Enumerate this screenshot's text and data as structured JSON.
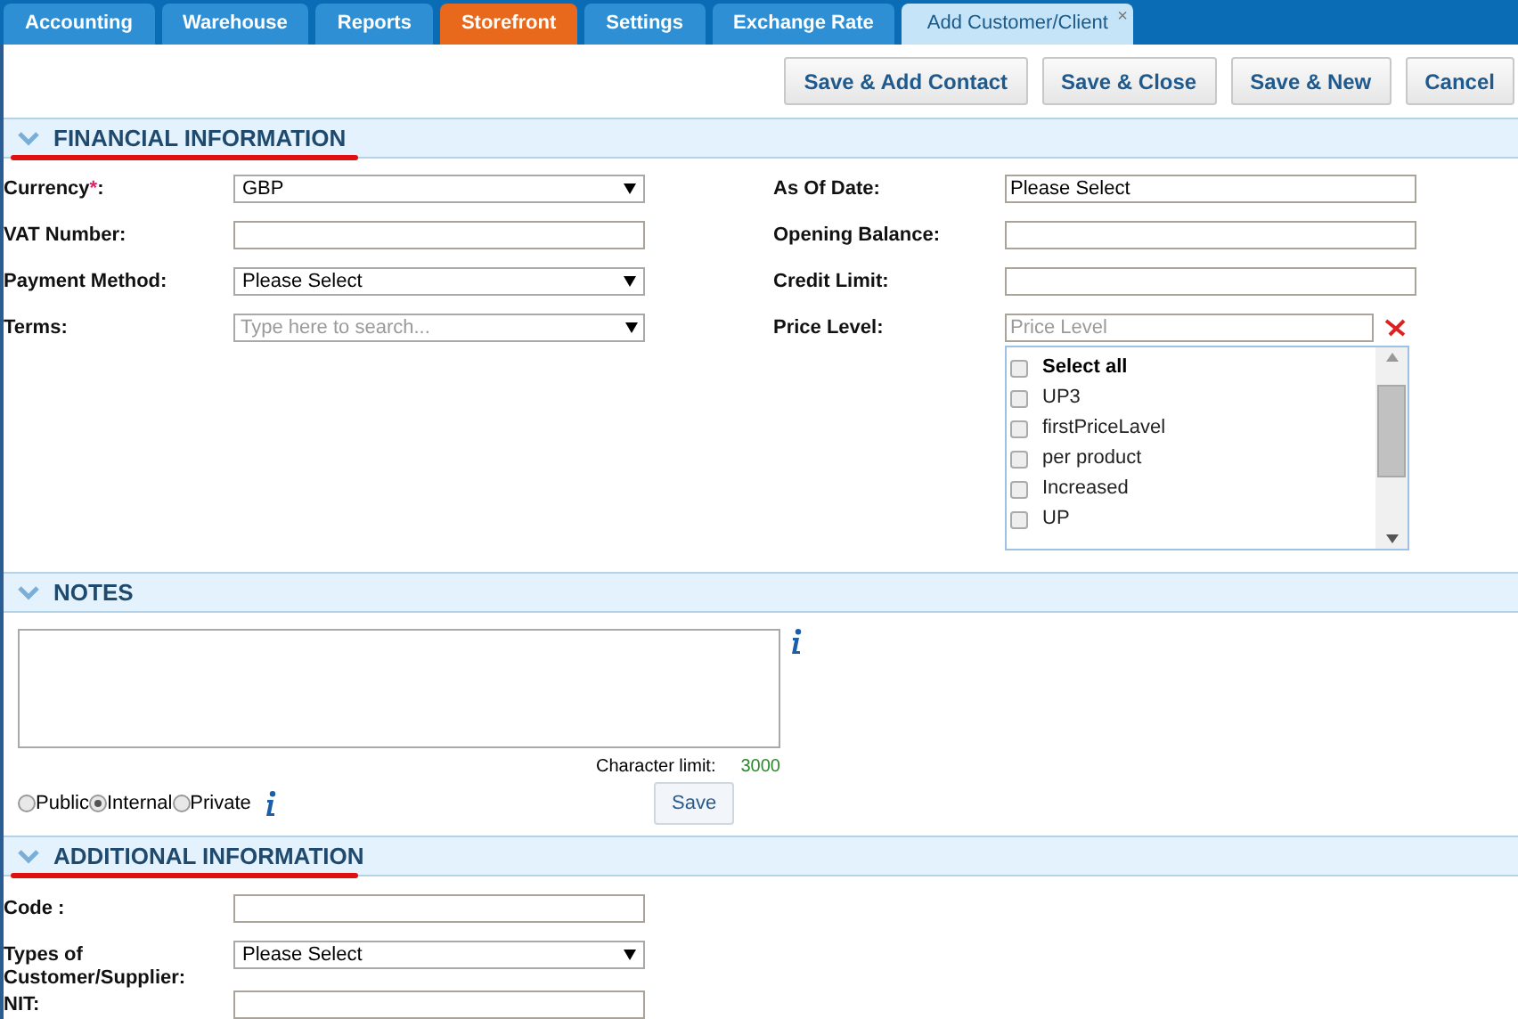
{
  "tabs": [
    {
      "label": "Accounting",
      "selected": false,
      "accent": false
    },
    {
      "label": "Warehouse",
      "selected": false,
      "accent": false
    },
    {
      "label": "Reports",
      "selected": false,
      "accent": false
    },
    {
      "label": "Storefront",
      "selected": false,
      "accent": true
    },
    {
      "label": "Settings",
      "selected": false,
      "accent": false
    },
    {
      "label": "Exchange Rate",
      "selected": false,
      "accent": false
    },
    {
      "label": "Add Customer/Client",
      "selected": true,
      "accent": false,
      "close": "×"
    }
  ],
  "toolbar": {
    "buttons": [
      "Save & Add Contact",
      "Save & Close",
      "Save & New",
      "Cancel"
    ]
  },
  "financial": {
    "title": "FINANCIAL INFORMATION",
    "marked": true,
    "left_fields": [
      {
        "kind": "select",
        "label": "Currency",
        "required_mark": "*",
        "label_end": ":",
        "value": "GBP"
      },
      {
        "kind": "text",
        "label": "VAT Number:"
      },
      {
        "kind": "select",
        "label": "Payment Method:",
        "value": "Please Select"
      },
      {
        "kind": "search",
        "label": "Terms:",
        "placeholder": "Type here to search..."
      }
    ],
    "right_fields": [
      {
        "kind": "text",
        "label": "As Of Date:",
        "value": "Please Select"
      },
      {
        "kind": "text",
        "label": "Opening Balance:"
      },
      {
        "kind": "text",
        "label": "Credit Limit:"
      },
      {
        "kind": "multiselect",
        "label": "Price Level:",
        "placeholder": "Price Level",
        "options": [
          {
            "label": "Select all",
            "checked": false,
            "kind": "all"
          },
          {
            "label": "UP3",
            "checked": false,
            "kind": "option"
          },
          {
            "label": "firstPriceLavel",
            "checked": false,
            "kind": "option"
          },
          {
            "label": "per product",
            "checked": false,
            "kind": "option"
          },
          {
            "label": "Increased",
            "checked": false,
            "kind": "option"
          },
          {
            "label": "UP",
            "checked": false,
            "kind": "option"
          }
        ]
      }
    ]
  },
  "notes": {
    "title": "NOTES",
    "char_limit_label": "Character limit:",
    "char_limit": "3000",
    "visibility": [
      {
        "label": "Public",
        "selected": false
      },
      {
        "label": "Internal",
        "selected": true
      },
      {
        "label": "Private",
        "selected": false
      }
    ],
    "save_button": "Save"
  },
  "additional": {
    "title": "ADDITIONAL INFORMATION",
    "marked": true,
    "fields": [
      {
        "kind": "text",
        "label": "Code :"
      },
      {
        "kind": "select",
        "label": "Types of Customer/Supplier:",
        "value": "Please Select"
      },
      {
        "kind": "text",
        "label": "NIT:"
      }
    ]
  }
}
